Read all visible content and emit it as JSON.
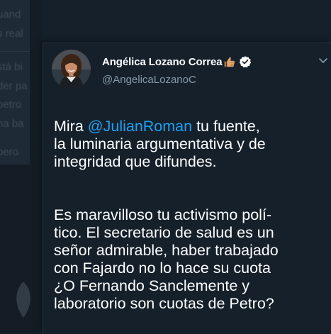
{
  "background": {
    "lines": [
      "uand",
      "s real",
      "stá bi",
      "der pa",
      "petro",
      "na ba",
      "pero"
    ]
  },
  "tweet": {
    "author": {
      "display_name": "Angélica Lozano Correa",
      "name_emoji": "thumbs-up-icon",
      "verified": true,
      "handle": "@AngelicaLozanoC"
    },
    "body": {
      "p1_prefix": "Mira ",
      "p1_mention": "@JulianRoman",
      "p1_rest": " tu fuente,\nla luminaria argumentativa y de\nintegridad que difundes.",
      "p2": "Es maravilloso tu activismo polí-\ntico. El secretario de salud es un\nseñor admirable, haber trabajado\ncon Fajardo no lo hace su cuota\n¿O Fernando Sanclemente y\nlaboratorio son cuotas de Petro?"
    }
  },
  "colors": {
    "background": "#15202b",
    "text": "#ffffff",
    "secondary_text": "#8899a6",
    "link": "#1da1f2"
  }
}
